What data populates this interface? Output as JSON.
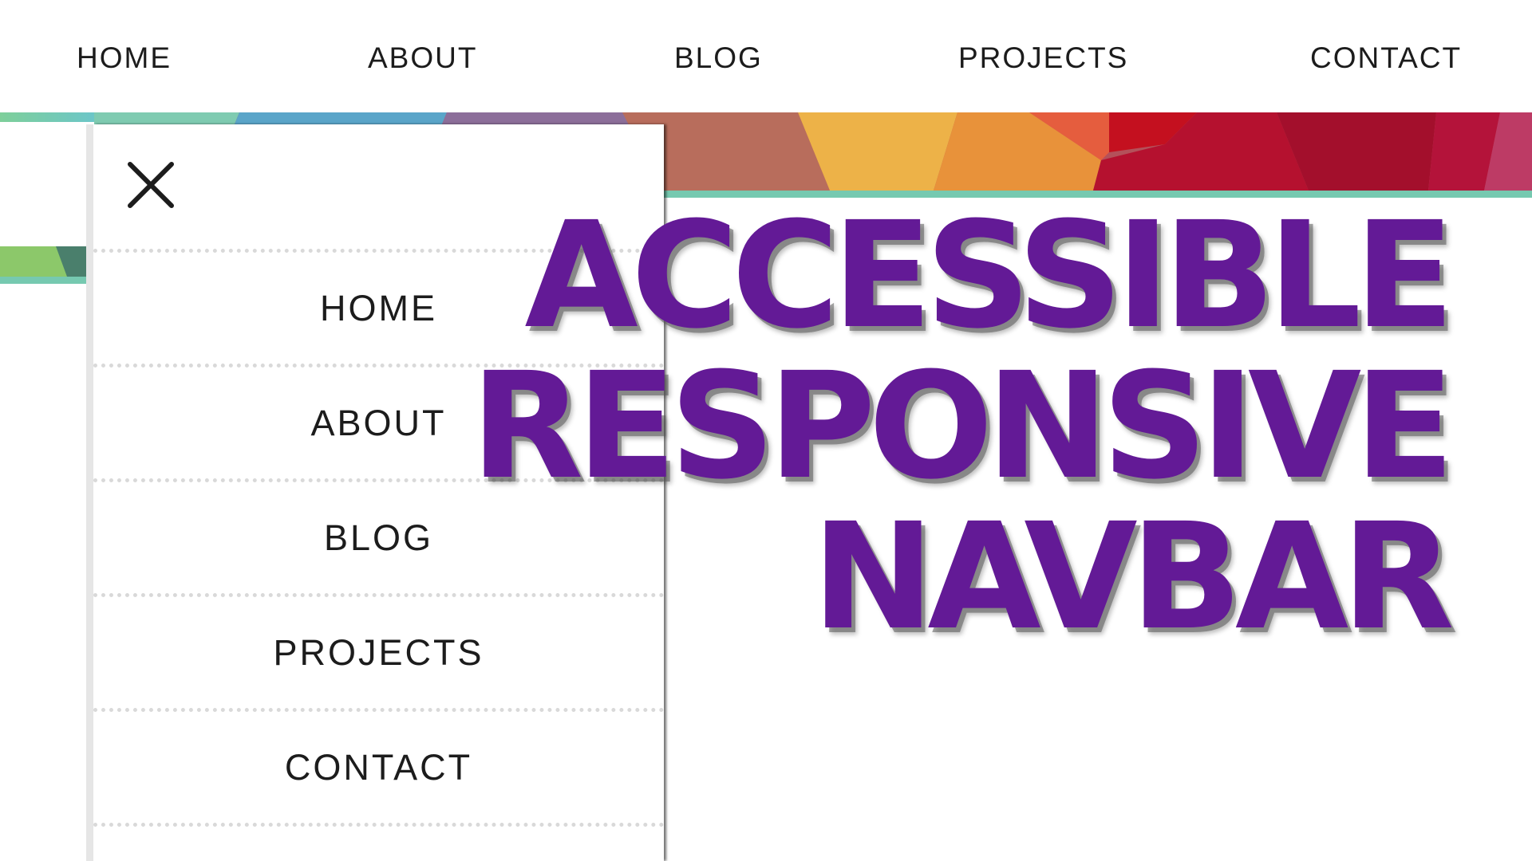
{
  "top_nav": {
    "items": [
      {
        "label": "HOME"
      },
      {
        "label": "ABOUT"
      },
      {
        "label": "BLOG"
      },
      {
        "label": "PROJECTS"
      },
      {
        "label": "CONTACT"
      }
    ]
  },
  "drawer": {
    "close_icon": "close-icon",
    "items": [
      {
        "label": "HOME"
      },
      {
        "label": "ABOUT"
      },
      {
        "label": "BLOG"
      },
      {
        "label": "PROJECTS"
      },
      {
        "label": "CONTACT"
      }
    ]
  },
  "headline": {
    "lines": [
      "ACCESSIBLE",
      "RESPONSIVE",
      "NAVBAR"
    ]
  },
  "colors": {
    "headline": "#631a96",
    "accent_line": "#76c9b0",
    "nav_text": "#1c1c1c",
    "divider": "#d9d9d9"
  }
}
